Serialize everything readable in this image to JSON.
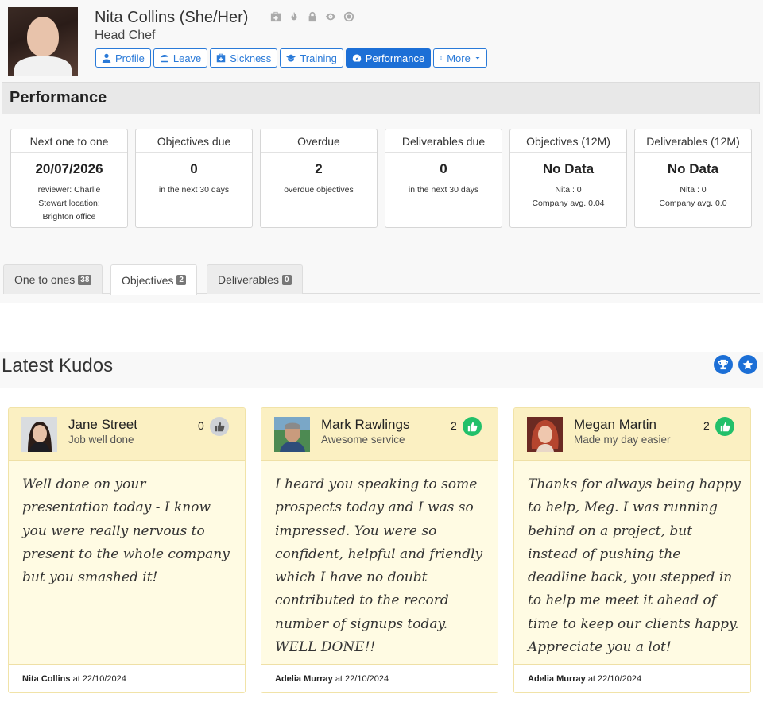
{
  "profile": {
    "name": "Nita Collins (She/Her)",
    "role": "Head Chef",
    "status_icons": [
      "medical-kit-icon",
      "flame-icon",
      "lock-icon",
      "eye-icon",
      "lifebuoy-icon"
    ]
  },
  "nav": {
    "profile": "Profile",
    "leave": "Leave",
    "sickness": "Sickness",
    "training": "Training",
    "performance": "Performance",
    "more": "More"
  },
  "performance": {
    "title": "Performance",
    "cards": [
      {
        "label": "Next one to one",
        "value": "20/07/2026",
        "lines": [
          "reviewer: Charlie",
          "Stewart location:",
          "Brighton office"
        ]
      },
      {
        "label": "Objectives due",
        "value": "0",
        "lines": [
          "in the next 30 days"
        ]
      },
      {
        "label": "Overdue",
        "value": "2",
        "lines": [
          "overdue objectives"
        ]
      },
      {
        "label": "Deliverables due",
        "value": "0",
        "lines": [
          "in the next 30 days"
        ]
      },
      {
        "label": "Objectives (12M)",
        "value": "No Data",
        "lines": [
          "Nita : 0",
          "Company avg. 0.04"
        ]
      },
      {
        "label": "Deliverables (12M)",
        "value": "No Data",
        "lines": [
          "Nita : 0",
          "Company avg. 0.0"
        ]
      }
    ],
    "tabs": [
      {
        "label": "One to ones",
        "count": "38"
      },
      {
        "label": "Objectives",
        "count": "2"
      },
      {
        "label": "Deliverables",
        "count": "0"
      }
    ],
    "active_tab": "Objectives"
  },
  "kudos": {
    "title": "Latest Kudos",
    "items": [
      {
        "name": "Jane Street",
        "reason": "Job well done",
        "likes": "0",
        "liked": false,
        "message": "Well done on your presentation today - I know you were really nervous to present to the whole company but you smashed it!",
        "author": "Nita Collins",
        "date_text": "at 22/10/2024"
      },
      {
        "name": "Mark Rawlings",
        "reason": "Awesome service",
        "likes": "2",
        "liked": true,
        "message": "I heard you speaking to some prospects today and I was so impressed. You were so confident, helpful and friendly which I have no doubt contributed to the record number of signups today. WELL DONE!!",
        "author": "Adelia Murray",
        "date_text": "at 22/10/2024"
      },
      {
        "name": "Megan Martin",
        "reason": "Made my day easier",
        "likes": "2",
        "liked": true,
        "message": "Thanks for always being happy to help, Meg. I was running behind on a project, but instead of pushing the deadline back, you stepped in to help me meet it ahead of time to keep our clients happy. Appreciate you a lot!",
        "author": "Adelia Murray",
        "date_text": "at 22/10/2024"
      }
    ]
  },
  "colors": {
    "accent": "#1c6fd6",
    "like_active": "#22c06a",
    "kudo_card_bg": "#fffbe3",
    "kudo_card_header": "#fbf0c2"
  }
}
